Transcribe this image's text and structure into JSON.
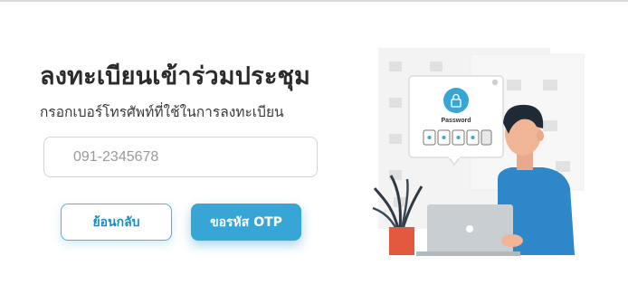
{
  "page": {
    "title": "ลงทะเบียนเข้าร่วมประชุม",
    "subtitle": "กรอกเบอร์โทรศัพท์ที่ใช้ในการลงทะเบียน"
  },
  "form": {
    "phone_placeholder": "091-2345678"
  },
  "buttons": {
    "back_label": "ย้อนกลับ",
    "otp_label": "ขอรหัส OTP"
  },
  "illustration": {
    "password_label": "Password",
    "icon": "padlock-icon"
  },
  "colors": {
    "accent": "#37a6d6",
    "title_text": "#2b2b2b"
  }
}
